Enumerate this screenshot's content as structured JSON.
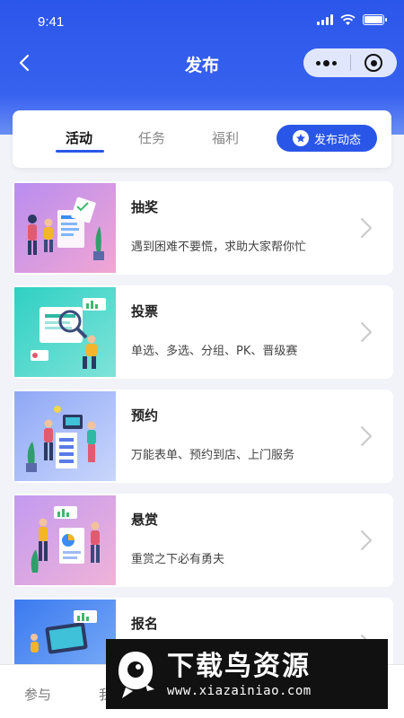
{
  "status_bar": {
    "time": "9:41"
  },
  "nav": {
    "title": "发布"
  },
  "tabs": [
    {
      "label": "活动",
      "active": true
    },
    {
      "label": "任务",
      "active": false
    },
    {
      "label": "福利",
      "active": false
    }
  ],
  "publish_button": {
    "label": "发布动态"
  },
  "items": [
    {
      "title": "抽奖",
      "desc": "遇到困难不要慌，求助大家帮你忙"
    },
    {
      "title": "投票",
      "desc": "单选、多选、分组、PK、晋级赛"
    },
    {
      "title": "预约",
      "desc": "万能表单、预约到店、上门服务"
    },
    {
      "title": "悬赏",
      "desc": "重赏之下必有勇夫"
    },
    {
      "title": "报名",
      "desc": ""
    }
  ],
  "bottom_tabs": [
    {
      "label": "参与"
    },
    {
      "label": "我"
    }
  ],
  "watermark": {
    "title": "下载鸟资源",
    "url": "www.xiazainiao.com"
  },
  "colors": {
    "primary": "#2a56e8",
    "background": "#f1f3f8"
  }
}
